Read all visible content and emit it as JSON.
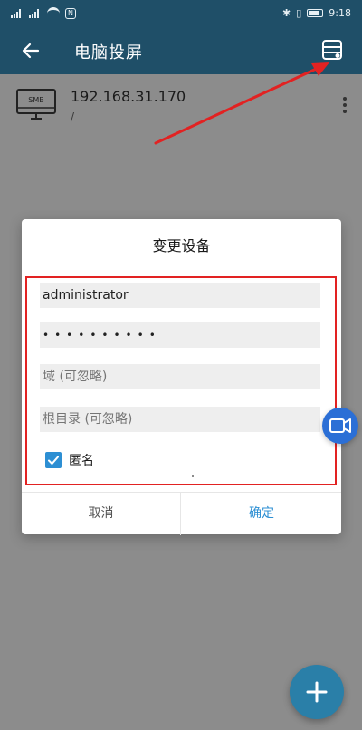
{
  "statusbar": {
    "time": "9:18",
    "battery_level": 0.8,
    "signal_bars": 4
  },
  "appbar": {
    "title": "电脑投屏",
    "back_icon": "arrow-left-icon",
    "server_icon": "server-icon"
  },
  "device": {
    "icon": "smb-monitor-icon",
    "icon_label": "SMB",
    "host": "192.168.31.170",
    "path": "/"
  },
  "dialog": {
    "title": "变更设备",
    "username_value": "administrator",
    "password_value": "••••••••••",
    "domain_placeholder": "域 (可忽略)",
    "root_placeholder": "根目录 (可忽略)",
    "anonymous_label": "匿名",
    "anonymous_checked": true,
    "cancel_label": "取消",
    "ok_label": "确定"
  },
  "colors": {
    "appbar": "#1f4f68",
    "accent": "#2d8fd3",
    "annotation": "#e22222",
    "fab": "#2a7fa8"
  }
}
